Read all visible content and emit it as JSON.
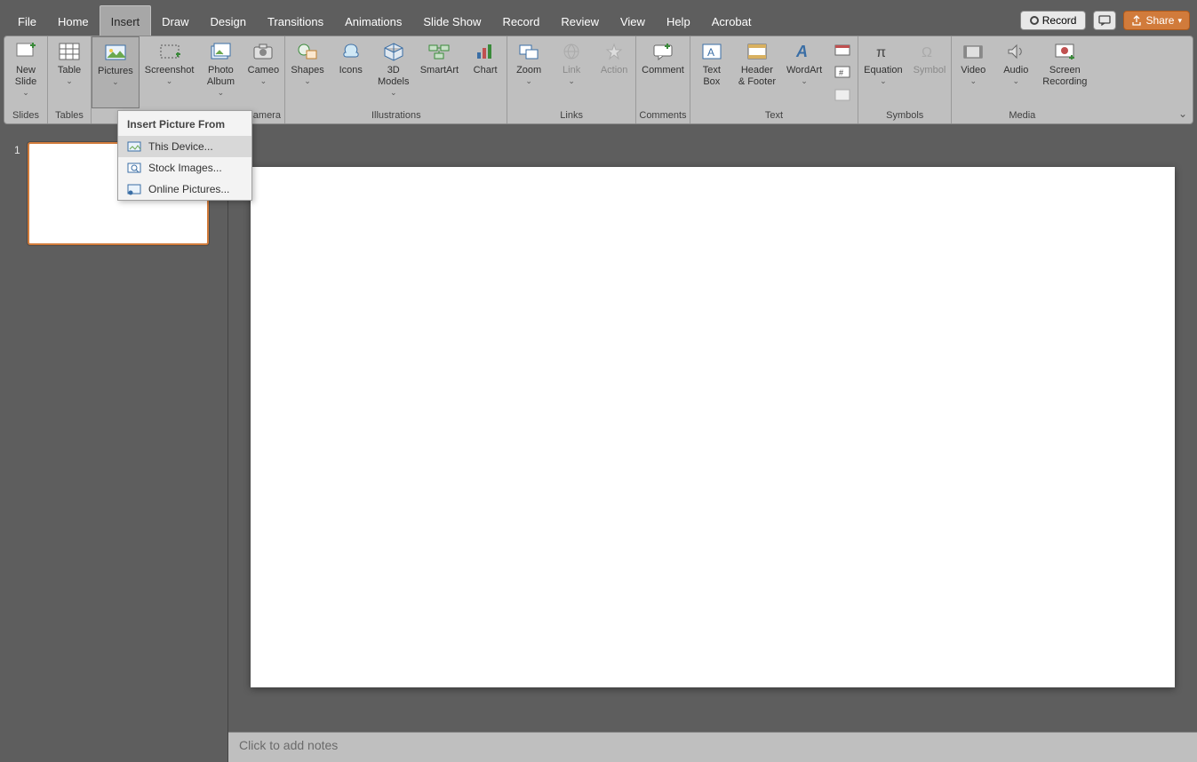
{
  "tabs": [
    "File",
    "Home",
    "Insert",
    "Draw",
    "Design",
    "Transitions",
    "Animations",
    "Slide Show",
    "Record",
    "Review",
    "View",
    "Help",
    "Acrobat"
  ],
  "active_tab": "Insert",
  "topright": {
    "record": "Record",
    "share": "Share"
  },
  "ribbon": {
    "slides": {
      "new_slide": "New\nSlide",
      "group": "Slides"
    },
    "tables": {
      "table": "Table",
      "group": "Tables"
    },
    "images": {
      "pictures": "Pictures",
      "screenshot": "Screenshot",
      "photo_album": "Photo\nAlbum"
    },
    "camera": {
      "cameo": "Cameo",
      "group": "Camera"
    },
    "illustrations": {
      "shapes": "Shapes",
      "icons": "Icons",
      "models": "3D\nModels",
      "smartart": "SmartArt",
      "chart": "Chart",
      "group": "Illustrations"
    },
    "links": {
      "zoom": "Zoom",
      "link": "Link",
      "action": "Action",
      "group": "Links"
    },
    "comments": {
      "comment": "Comment",
      "group": "Comments"
    },
    "text": {
      "textbox": "Text\nBox",
      "header": "Header\n& Footer",
      "wordart": "WordArt",
      "group": "Text"
    },
    "symbols": {
      "equation": "Equation",
      "symbol": "Symbol",
      "group": "Symbols"
    },
    "media": {
      "video": "Video",
      "audio": "Audio",
      "screenrec": "Screen\nRecording",
      "group": "Media"
    }
  },
  "dropdown": {
    "header": "Insert Picture From",
    "items": [
      "This Device...",
      "Stock Images...",
      "Online Pictures..."
    ]
  },
  "slide_number": "1",
  "notes_placeholder": "Click to add notes"
}
